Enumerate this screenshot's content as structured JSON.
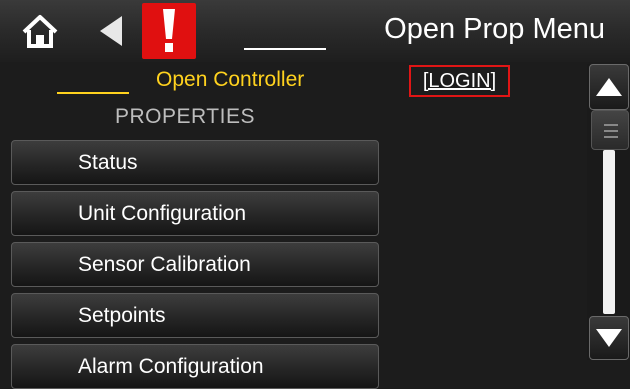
{
  "topbar": {
    "home_icon": "home-icon",
    "back_icon": "back-arrow-icon",
    "alarm_icon": "alarm-exclamation-icon",
    "title": "Open Prop Menu",
    "colors": {
      "alarm": "#e01010",
      "text": "#ffffff"
    }
  },
  "controller": {
    "name": "Open Controller",
    "login_label": "[LOGIN]",
    "colors": {
      "name": "#ffd21e",
      "login_border": "#e01515"
    }
  },
  "section_title": "PROPERTIES",
  "menu": {
    "items": [
      {
        "label": "Status"
      },
      {
        "label": "Unit Configuration"
      },
      {
        "label": "Sensor Calibration"
      },
      {
        "label": "Setpoints"
      },
      {
        "label": "Alarm Configuration"
      }
    ]
  },
  "scrollbar": {
    "up_icon": "scroll-up-arrow-icon",
    "down_icon": "scroll-down-arrow-icon"
  }
}
